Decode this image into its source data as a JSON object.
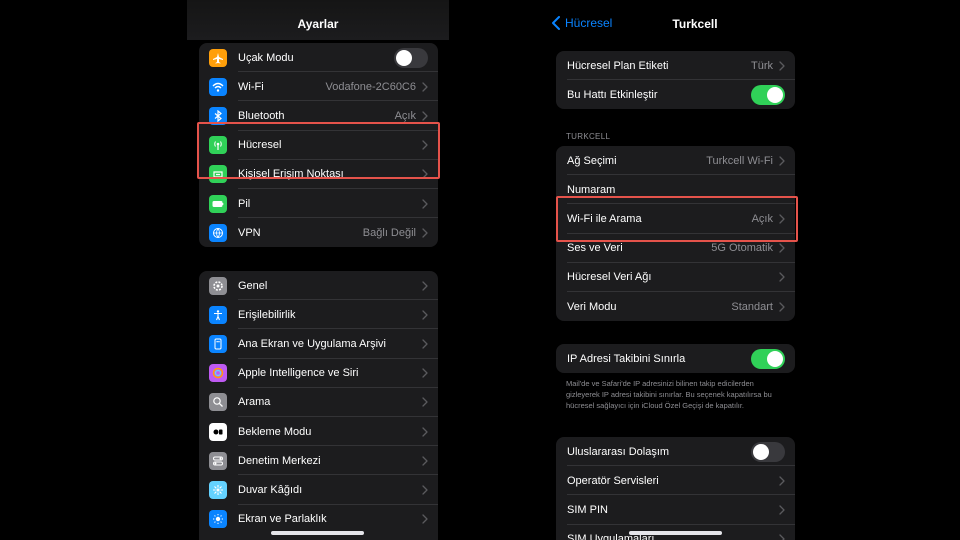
{
  "left": {
    "title": "Ayarlar",
    "group1": [
      {
        "label": "Uçak Modu",
        "toggle": "off",
        "icon": "airplane-icon",
        "color": "#ff9f0a"
      },
      {
        "label": "Wi-Fi",
        "value": "Vodafone-2C60C6",
        "icon": "wifi-icon",
        "color": "#0a84ff"
      },
      {
        "label": "Bluetooth",
        "value": "Açık",
        "icon": "bluetooth-icon",
        "color": "#0a84ff"
      },
      {
        "label": "Hücresel",
        "value": "",
        "icon": "cellular-antenna-icon",
        "color": "#30d158"
      },
      {
        "label": "Kişisel Erişim Noktası",
        "value": "",
        "icon": "hotspot-icon",
        "color": "#30d158"
      },
      {
        "label": "Pil",
        "value": "",
        "icon": "battery-icon",
        "color": "#30d158"
      },
      {
        "label": "VPN",
        "value": "Bağlı Değil",
        "icon": "globe-icon",
        "color": "#0a84ff"
      }
    ],
    "group2": [
      {
        "label": "Genel",
        "icon": "gear-icon",
        "color": "#8e8e93"
      },
      {
        "label": "Erişilebilirlik",
        "icon": "accessibility-icon",
        "color": "#0a84ff"
      },
      {
        "label": "Ana Ekran ve Uygulama Arşivi",
        "icon": "home-screen-icon",
        "color": "#0a84ff"
      },
      {
        "label": "Apple Intelligence ve Siri",
        "icon": "siri-icon",
        "color": "#bf5af2"
      },
      {
        "label": "Arama",
        "icon": "search-icon",
        "color": "#8e8e93"
      },
      {
        "label": "Bekleme Modu",
        "icon": "standby-icon",
        "color": "#ffffff"
      },
      {
        "label": "Denetim Merkezi",
        "icon": "control-center-icon",
        "color": "#8e8e93"
      },
      {
        "label": "Duvar Kâğıdı",
        "icon": "wallpaper-icon",
        "color": "#64d2ff"
      },
      {
        "label": "Ekran ve Parlaklık",
        "icon": "brightness-icon",
        "color": "#0a84ff"
      }
    ]
  },
  "right": {
    "back_label": "Hücresel",
    "title": "Turkcell",
    "group1": [
      {
        "label": "Hücresel Plan Etiketi",
        "value": "Türk",
        "chevron": true
      },
      {
        "label": "Bu Hattı Etkinleştir",
        "toggle": "on"
      }
    ],
    "section_header": "TURKCELL",
    "group2": [
      {
        "label": "Ağ Seçimi",
        "value": "Turkcell Wi-Fi",
        "chevron": true
      },
      {
        "label": "Numaram",
        "value": "",
        "chevron": false
      },
      {
        "label": "Wi-Fi ile Arama",
        "value": "Açık",
        "chevron": true
      },
      {
        "label": "Ses ve Veri",
        "value": "5G Otomatik",
        "chevron": true
      },
      {
        "label": "Hücresel Veri Ağı",
        "value": "",
        "chevron": true
      },
      {
        "label": "Veri Modu",
        "value": "Standart",
        "chevron": true
      }
    ],
    "group3": [
      {
        "label": "IP Adresi Takibini Sınırla",
        "toggle": "on"
      }
    ],
    "footnote": "Mail'de ve Safari'de IP adresinizi bilinen takip edicilerden gizleyerek IP adresi takibini sınırlar. Bu seçenek kapatılırsa bu hücresel sağlayıcı için iCloud Özel Geçişi de kapatılır.",
    "group4": [
      {
        "label": "Uluslararası Dolaşım",
        "toggle": "off"
      },
      {
        "label": "Operatör Servisleri",
        "value": "",
        "chevron": true
      },
      {
        "label": "SIM PIN",
        "value": "",
        "chevron": true
      },
      {
        "label": "SIM Uygulamaları",
        "value": "",
        "chevron": true
      }
    ]
  },
  "colors": {
    "highlight": "#e5534b",
    "accent_blue": "#0a84ff",
    "toggle_on": "#30d158",
    "cell_bg": "#1c1c1e",
    "secondary_text": "#8e8e93"
  }
}
